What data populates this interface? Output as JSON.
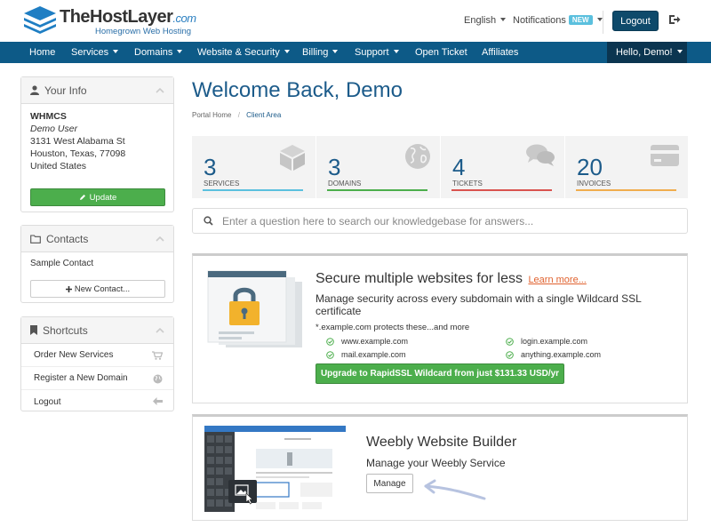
{
  "brand": {
    "name": "TheHostLayer",
    "suffix": ".com",
    "tagline": "Homegrown Web Hosting",
    "accent": "#0d5a87",
    "accent_dark": "#0b3550",
    "success": "#4cae4c"
  },
  "header": {
    "language": "English",
    "notifications": "Notifications",
    "notifications_badge": "NEW",
    "logout": "Logout",
    "exit_icon": "sign-out-icon"
  },
  "nav": {
    "items": [
      "Home",
      "Services",
      "Domains",
      "Website & Security",
      "Billing",
      "Support",
      "Open Ticket",
      "Affiliates"
    ],
    "user": "Hello, Demo!"
  },
  "sidebar": {
    "info": {
      "title": "Your Info",
      "company": "WHMCS",
      "name": "Demo User",
      "address1": "3131 West Alabama St",
      "address2": "Houston, Texas, 77098",
      "country": "United States",
      "update": "Update"
    },
    "contacts": {
      "title": "Contacts",
      "item": "Sample Contact",
      "new": "New Contact..."
    },
    "shortcuts": {
      "title": "Shortcuts",
      "items": [
        "Order New Services",
        "Register a New Domain",
        "Logout"
      ]
    }
  },
  "main": {
    "title": "Welcome Back, Demo",
    "breadcrumb": [
      "Portal Home",
      "/",
      "Client Area"
    ],
    "tiles": [
      {
        "value": "3",
        "label": "Services",
        "color": "#5bc0de"
      },
      {
        "value": "3",
        "label": "Domains",
        "color": "#4cae4c"
      },
      {
        "value": "4",
        "label": "Tickets",
        "color": "#d9534f"
      },
      {
        "value": "20",
        "label": "Invoices",
        "color": "#f0ad4e"
      }
    ],
    "search_placeholder": "Enter a question here to search our knowledgebase for answers...",
    "promo": {
      "title": "Secure multiple websites for less",
      "learn_more": "Learn more...",
      "subtitle": "Manage security across every subdomain with a single Wildcard SSL certificate",
      "note": "*.example.com protects these...and more",
      "domains": [
        "www.example.com",
        "login.example.com",
        "mail.example.com",
        "anything.example.com"
      ],
      "button": "Upgrade to RapidSSL Wildcard from just $131.33 USD/yr"
    },
    "weebly": {
      "title": "Weebly Website Builder",
      "subtitle": "Manage your Weebly Service",
      "button": "Manage"
    }
  }
}
